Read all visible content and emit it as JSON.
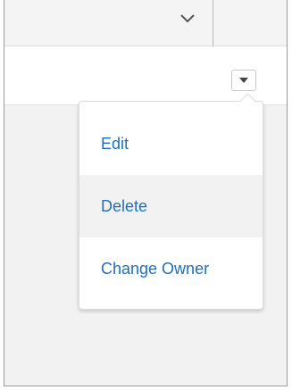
{
  "header": {
    "chevron_icon": "chevron-down-icon"
  },
  "row": {
    "action_icon": "caret-down-icon"
  },
  "menu": {
    "items": [
      {
        "label": "Edit",
        "state": "default"
      },
      {
        "label": "Delete",
        "state": "hover"
      },
      {
        "label": "Change Owner",
        "state": "default"
      }
    ]
  },
  "colors": {
    "link": "#1f6fbf",
    "hover_bg": "#f3f2f2",
    "menu_bg": "#ffffff",
    "panel_bg": "#f2f2f2"
  }
}
